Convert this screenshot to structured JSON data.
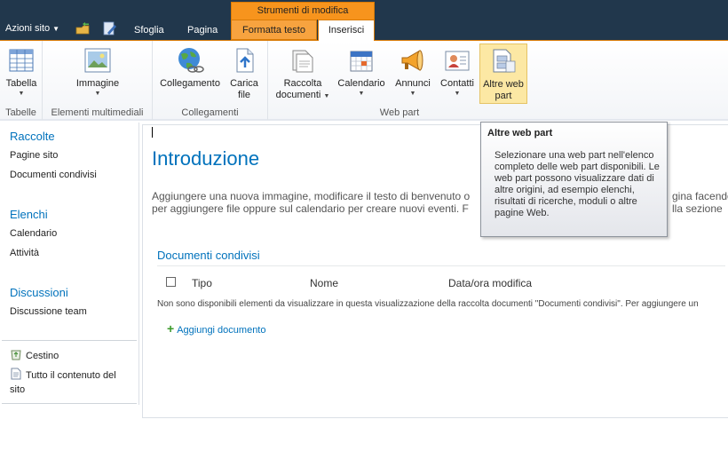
{
  "topbar": {
    "site_actions": "Azioni sito",
    "tabs": [
      "Sfoglia",
      "Pagina"
    ],
    "context_group": "Strumenti di modifica",
    "context_tabs": [
      "Formatta testo",
      "Inserisci"
    ]
  },
  "ribbon": {
    "groups": {
      "tabelle": "Tabelle",
      "media": "Elementi multimediali",
      "collegamenti": "Collegamenti",
      "webpart": "Web part"
    },
    "buttons": {
      "tabella": "Tabella",
      "immagine": "Immagine",
      "collegamento": "Collegamento",
      "carica_1": "Carica",
      "carica_2": "file",
      "raccolta_1": "Raccolta",
      "raccolta_2": "documenti",
      "calendario": "Calendario",
      "annunci": "Annunci",
      "contatti": "Contatti",
      "altre_1": "Altre web",
      "altre_2": "part"
    }
  },
  "leftnav": {
    "raccolte": "Raccolte",
    "pagine_sito": "Pagine sito",
    "documenti_condivisi": "Documenti condivisi",
    "elenchi": "Elenchi",
    "calendario": "Calendario",
    "attivita": "Attività",
    "discussioni": "Discussioni",
    "discussione_team": "Discussione team",
    "cestino": "Cestino",
    "tutto_contenuto_1": "Tutto il contenuto del",
    "tutto_contenuto_2": "sito"
  },
  "main": {
    "title": "Introduzione",
    "intro_line_1": "Aggiungere una nuova immagine, modificare il testo di benvenuto o",
    "intro_line_2": "per aggiungere file oppure sul calendario per creare nuovi eventi. F",
    "intro_line_1_end": "gina facendo",
    "intro_line_2_end": "lla sezione",
    "webpart_title": "Documenti condivisi",
    "columns": [
      "Tipo",
      "Nome",
      "Data/ora modifica"
    ],
    "empty_message": "Non sono disponibili elementi da visualizzare in questa visualizzazione della raccolta documenti \"Documenti condivisi\". Per aggiungere un",
    "add_document": "Aggiungi documento"
  },
  "tooltip": {
    "title": "Altre web part",
    "body": "Selezionare una web part nell'elenco completo delle web part disponibili. Le web part possono visualizzare dati di altre origini, ad esempio elenchi, risultati di ricerche, moduli o altre pagine Web."
  }
}
